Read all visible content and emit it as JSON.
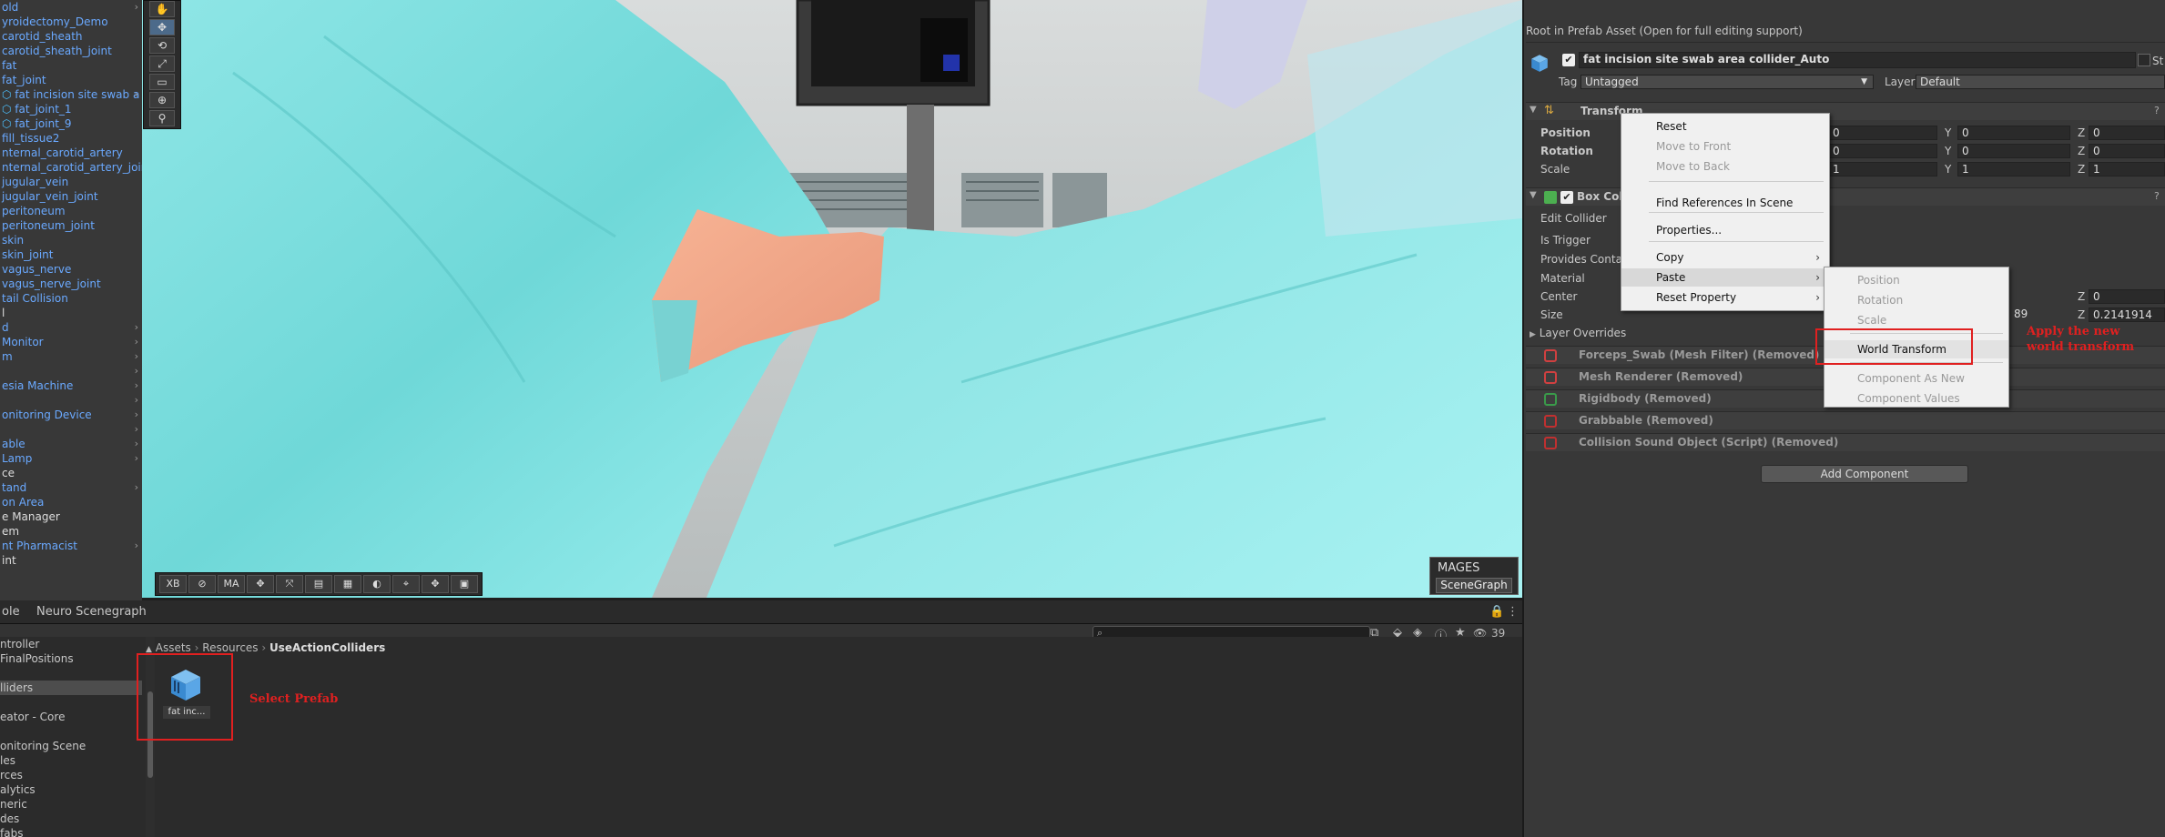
{
  "hierarchy": [
    {
      "label": "old",
      "color": "blue",
      "arrow": true
    },
    {
      "label": "yroidectomy_Demo",
      "color": "blue"
    },
    {
      "label": "carotid_sheath",
      "color": "blue"
    },
    {
      "label": "carotid_sheath_joint",
      "color": "blue"
    },
    {
      "label": "fat",
      "color": "blue"
    },
    {
      "label": "fat_joint",
      "color": "blue"
    },
    {
      "label": "fat incision site swab a",
      "color": "blue",
      "arrow": true,
      "icon": true
    },
    {
      "label": "fat_joint_1",
      "color": "blue",
      "icon": true
    },
    {
      "label": "fat_joint_9",
      "color": "blue",
      "icon": true
    },
    {
      "label": "fill_tissue2",
      "color": "blue"
    },
    {
      "label": "nternal_carotid_artery",
      "color": "blue"
    },
    {
      "label": "nternal_carotid_artery_joint",
      "color": "blue"
    },
    {
      "label": "jugular_vein",
      "color": "blue"
    },
    {
      "label": "jugular_vein_joint",
      "color": "blue"
    },
    {
      "label": "peritoneum",
      "color": "blue"
    },
    {
      "label": "peritoneum_joint",
      "color": "blue"
    },
    {
      "label": "skin",
      "color": "blue"
    },
    {
      "label": "skin_joint",
      "color": "blue"
    },
    {
      "label": "vagus_nerve",
      "color": "blue"
    },
    {
      "label": "vagus_nerve_joint",
      "color": "blue"
    },
    {
      "label": "tail Collision",
      "color": "blue"
    },
    {
      "label": "l",
      "color": "white"
    },
    {
      "label": "d",
      "color": "blue",
      "arrow": true
    },
    {
      "label": "Monitor",
      "color": "blue",
      "arrow": true
    },
    {
      "label": "m",
      "color": "blue",
      "arrow": true
    },
    {
      "label": "",
      "color": "white",
      "arrow": true
    },
    {
      "label": "esia Machine",
      "color": "blue",
      "arrow": true
    },
    {
      "label": "",
      "color": "white",
      "arrow": true
    },
    {
      "label": "onitoring Device",
      "color": "blue",
      "arrow": true
    },
    {
      "label": "",
      "color": "white",
      "arrow": true
    },
    {
      "label": "able",
      "color": "blue",
      "arrow": true
    },
    {
      "label": "Lamp",
      "color": "blue",
      "arrow": true
    },
    {
      "label": "ce",
      "color": "white"
    },
    {
      "label": "tand",
      "color": "blue",
      "arrow": true
    },
    {
      "label": "on Area",
      "color": "blue"
    },
    {
      "label": "e Manager",
      "color": "white"
    },
    {
      "label": "em",
      "color": "white"
    },
    {
      "label": "nt Pharmacist",
      "color": "blue",
      "arrow": true
    },
    {
      "label": "int",
      "color": "white"
    }
  ],
  "scene": {
    "side_tools": [
      "hand-tool",
      "move-tool",
      "rotate-tool",
      "scale-tool",
      "rect-tool",
      "transform-tool",
      "custom-tool"
    ],
    "bottom_tools": [
      "XB",
      "⊘",
      "MA",
      "✥",
      "⤧",
      "▤",
      "▦",
      "◐",
      "⌖",
      "✥",
      "▣"
    ],
    "mages_label": "MAGES",
    "scenegraph_button": "SceneGraph"
  },
  "bottom_panel": {
    "tabs": [
      "ole",
      "Neuro Scenegraph"
    ],
    "search_placeholder": "",
    "item_count": "39",
    "breadcrumb": [
      "Assets",
      "Resources",
      "UseActionColliders"
    ],
    "left_items": [
      "ntroller",
      "FinalPositions",
      "",
      "lliders",
      "",
      "eator - Core",
      "",
      "onitoring Scene",
      "les",
      "rces",
      "alytics",
      "neric",
      "des",
      "fabs"
    ],
    "selected_left": "lliders",
    "asset_label": "fat inc...",
    "annotation_select": "Select Prefab"
  },
  "inspector": {
    "header": "Root in Prefab Asset (Open for full editing support)",
    "object_name": "fat incision site swab area collider_Auto",
    "static_label": "St",
    "tag_label": "Tag",
    "tag_value": "Untagged",
    "layer_label": "Layer",
    "layer_value": "Default",
    "transform_title": "Transform",
    "position_label": "Position",
    "rotation_label": "Rotation",
    "scale_label": "Scale",
    "position": {
      "x": "0",
      "y": "0",
      "z": "0"
    },
    "rotation": {
      "x": "0",
      "y": "0",
      "z": "0"
    },
    "scale": {
      "x": "1",
      "y": "1",
      "z": "1"
    },
    "box_collider_title": "Box Colli",
    "edit_collider": "Edit Collider",
    "is_trigger": "Is Trigger",
    "provides_contacts": "Provides Conta",
    "material": "Material",
    "center": "Center",
    "center_z": "0",
    "size": "Size",
    "size_y_partial": "89",
    "size_z": "0.2141914",
    "layer_overrides": "Layer Overrides",
    "removed_components": [
      "Forceps_Swab (Mesh Filter) (Removed)",
      "Mesh Renderer (Removed)",
      "Rigidbody (Removed)",
      "Grabbable (Removed)",
      "Collision Sound Object (Script) (Removed)"
    ],
    "add_component": "Add Component"
  },
  "context_menu": {
    "items": [
      "Reset",
      "Move to Front",
      "Move to Back",
      "Find References In Scene",
      "Properties...",
      "Copy",
      "Paste",
      "Reset Property"
    ],
    "paste_submenu": [
      "Position",
      "Rotation",
      "Scale",
      "World Transform",
      "Component As New",
      "Component Values"
    ]
  },
  "annotation_apply": "Apply the new world transform",
  "colors": {
    "accent": "#4c8ad6",
    "annotation": "#e02020",
    "drape": "#7fe0e0"
  }
}
